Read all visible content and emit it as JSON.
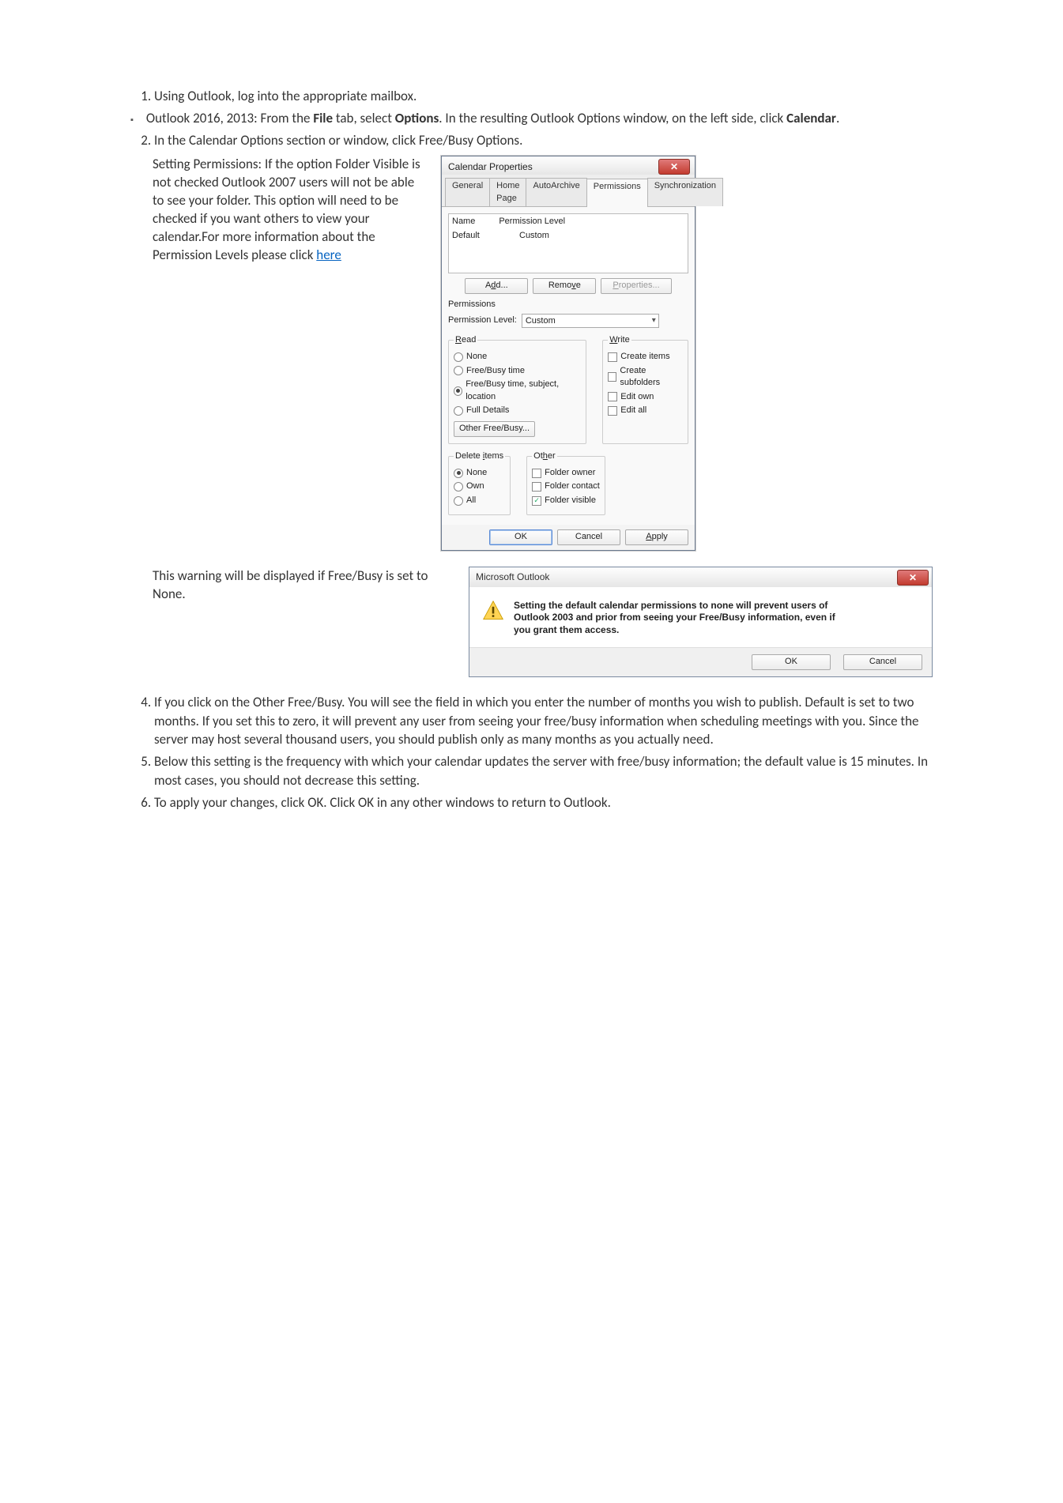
{
  "steps": {
    "s1": "Using Outlook, log into the appropriate mailbox.",
    "s1_sub_pre": "Outlook 2016, 2013: From the ",
    "s1_sub_file": "File",
    "s1_sub_mid": " tab, select ",
    "s1_sub_options": "Options",
    "s1_sub_post": ". In the resulting Outlook Options window, on the left side, click ",
    "s1_sub_calendar": "Calendar",
    "s2": "In the Calendar Options section or window, click Free/Busy Options.",
    "s3_text": "Setting Permissions: If the option Folder Visible is not checked Outlook 2007 users will not be able to see your folder. This option will need to be checked if you want others to view your calendar.For more information about the Permission Levels please click ",
    "s3_link": "here",
    "warning_left": "This warning will be displayed if Free/Busy is set to None.",
    "s4": "If you click on the Other Free/Busy. You will see the field in which you enter the number of months you wish to publish. Default is set to two months. If you set this to zero, it will prevent any user from seeing your free/busy information when scheduling meetings with you. Since the server may host several thousand users, you should publish only as many months as you actually need.",
    "s5": "Below this setting is the frequency with which your calendar updates the server with free/busy information; the default value is 15 minutes. In most cases, you should not decrease this setting.",
    "s6": "To apply your changes, click OK. Click OK in any other windows to return to Outlook."
  },
  "dlg1": {
    "title": "Calendar Properties",
    "tabs": {
      "general": "General",
      "home": "Home Page",
      "auto": "AutoArchive",
      "perm": "Permissions",
      "sync": "Synchronization"
    },
    "list": {
      "h_name": "Name",
      "h_perm": "Permission Level",
      "row_name": "Default",
      "row_perm": "Custom"
    },
    "btn_add": "Add...",
    "btn_remove": "Remove",
    "btn_properties": "Properties...",
    "permissions_label": "Permissions",
    "permlevel_label": "Permission Level:",
    "permlevel_value": "Custom",
    "read": {
      "label": "Read",
      "none": "None",
      "fb": "Free/Busy time",
      "fbsl": "Free/Busy time, subject, location",
      "full": "Full Details",
      "other_btn": "Other Free/Busy..."
    },
    "write": {
      "label": "Write",
      "create": "Create items",
      "createsub": "Create subfolders",
      "editown": "Edit own",
      "editall": "Edit all"
    },
    "delete": {
      "label": "Delete items",
      "none": "None",
      "own": "Own",
      "all": "All"
    },
    "other": {
      "label": "Other",
      "fowner": "Folder owner",
      "fcontact": "Folder contact",
      "fvisible": "Folder visible"
    },
    "ok": "OK",
    "cancel": "Cancel",
    "apply": "Apply"
  },
  "dlg2": {
    "title": "Microsoft Outlook",
    "msg": "Setting the default calendar permissions to none will prevent users of Outlook 2003 and prior from seeing your Free/Busy information, even if you grant them access.",
    "ok": "OK",
    "cancel": "Cancel"
  }
}
